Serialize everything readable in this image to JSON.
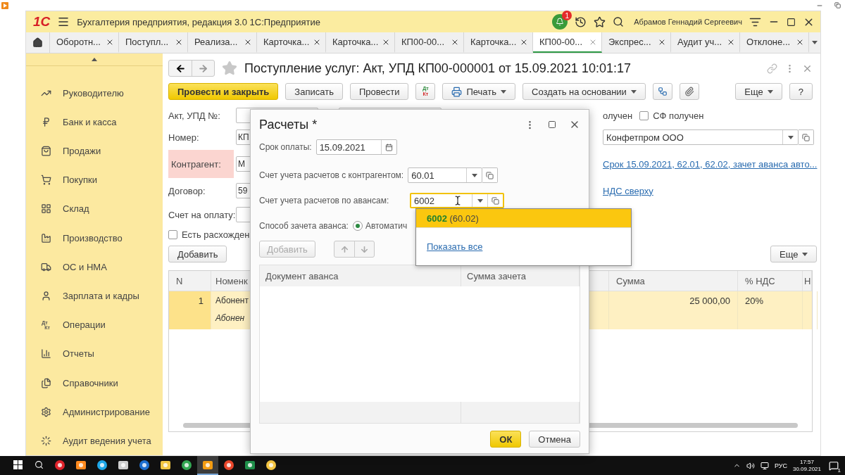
{
  "app": {
    "logo": "1С",
    "title": "Бухгалтерия предприятия, редакция 3.0 1С:Предприятие",
    "notifications": "1",
    "user": "Абрамов Геннадий Сергеевич"
  },
  "tabs": [
    {
      "label": "Оборотн...",
      "selected": false
    },
    {
      "label": "Поступл...",
      "selected": false
    },
    {
      "label": "Реализа...",
      "selected": false
    },
    {
      "label": "Карточка...",
      "selected": false
    },
    {
      "label": "Карточка...",
      "selected": false
    },
    {
      "label": "КП00-00...",
      "selected": false
    },
    {
      "label": "Карточка...",
      "selected": false
    },
    {
      "label": "КП00-00...",
      "selected": true
    },
    {
      "label": "Экспрес...",
      "selected": false
    },
    {
      "label": "Аудит уч...",
      "selected": false
    },
    {
      "label": "Отклоне...",
      "selected": false
    }
  ],
  "sidebar": {
    "items": [
      {
        "label": "Руководителю"
      },
      {
        "label": "Банк и касса"
      },
      {
        "label": "Продажи"
      },
      {
        "label": "Покупки"
      },
      {
        "label": "Склад"
      },
      {
        "label": "Производство"
      },
      {
        "label": "ОС и НМА"
      },
      {
        "label": "Зарплата и кадры"
      },
      {
        "label": "Операции",
        "icon_text": [
          "Дт",
          "Кт"
        ]
      },
      {
        "label": "Отчеты"
      },
      {
        "label": "Справочники"
      },
      {
        "label": "Администрирование"
      },
      {
        "label": "Аудит ведения учета"
      }
    ]
  },
  "document": {
    "title": "Поступление услуг: Акт, УПД КП00-000001 от 15.09.2021 10:01:17",
    "toolbar": {
      "left": [
        {
          "kind": "primary",
          "label": "Провести и закрыть"
        },
        {
          "kind": "button",
          "label": "Записать"
        },
        {
          "kind": "button",
          "label": "Провести"
        },
        {
          "kind": "dtkt",
          "top": "Дт",
          "bottom": "Кт"
        },
        {
          "kind": "print",
          "label": "Печать"
        },
        {
          "kind": "menu",
          "label": "Создать на основании"
        },
        {
          "kind": "icon"
        },
        {
          "kind": "icon"
        }
      ],
      "right": [
        {
          "kind": "menu",
          "label": "Еще"
        },
        {
          "kind": "button",
          "label": "?"
        }
      ]
    },
    "form": {
      "rows": [
        {
          "label": "Акт, УПД №:",
          "invalid": false,
          "extra_field": true
        },
        {
          "label": "Номер:",
          "value": "КП",
          "invalid": false,
          "extra_field": false
        },
        {
          "label": "Контрагент:",
          "value": "М",
          "invalid": true,
          "extra_field": false
        },
        {
          "label": "Договор:",
          "value": "59",
          "invalid": false,
          "extra_field": false
        },
        {
          "label": "Счет на оплату:",
          "invalid": false,
          "extra_field": false
        }
      ],
      "discrepancy": {
        "label": "Есть расхожден",
        "checked": false
      },
      "received_text": "олучен",
      "sf_received": {
        "label": "СФ получен",
        "checked": false
      },
      "organization": "Конфетпром ООО",
      "payment_link": "Срок 15.09.2021, 62.01, 62.02, зачет аванса авто...",
      "vat_link": "НДС сверху",
      "add_button": "Добавить",
      "more_button": "Еще"
    },
    "table": {
      "columns": [
        "N",
        "Номенк",
        "Сумма",
        "% НДС",
        "Н"
      ],
      "rows": [
        {
          "n": "1",
          "name": "Абонент",
          "name_line2": "Абонен",
          "sum": "25 000,00",
          "vat": "20%",
          "selected": true
        }
      ]
    }
  },
  "dialog": {
    "title": "Расчеты *",
    "due_label": "Срок оплаты:",
    "due_value": "15.09.2021",
    "account_label": "Счет учета расчетов с контрагентом:",
    "account_value": "60.01",
    "advance_label": "Счет учета расчетов по авансам:",
    "advance_value": "6002",
    "offset_label": "Способ зачета аванса:",
    "offset_option": {
      "label": "Автоматич",
      "selected": true
    },
    "add_button": {
      "label": "Добавить",
      "disabled": true
    },
    "columns": [
      "Документ аванса",
      "Сумма зачета"
    ],
    "ok": "ОК",
    "cancel": "Отмена"
  },
  "suggestions": {
    "items": [
      {
        "text": "**6002** (60.02)",
        "selected": true
      }
    ],
    "show_all": "Показать все"
  },
  "taskbar": {
    "apps": [
      {
        "selected": false
      },
      {
        "selected": false
      },
      {
        "selected": false
      },
      {
        "selected": false
      },
      {
        "selected": false
      },
      {
        "selected": false
      },
      {
        "selected": false
      },
      {
        "selected": true
      },
      {
        "selected": false
      },
      {
        "selected": false
      },
      {
        "selected": false
      }
    ],
    "language": "РУС",
    "time": "17:57",
    "date": "30.09.2021",
    "notifications": "1"
  }
}
